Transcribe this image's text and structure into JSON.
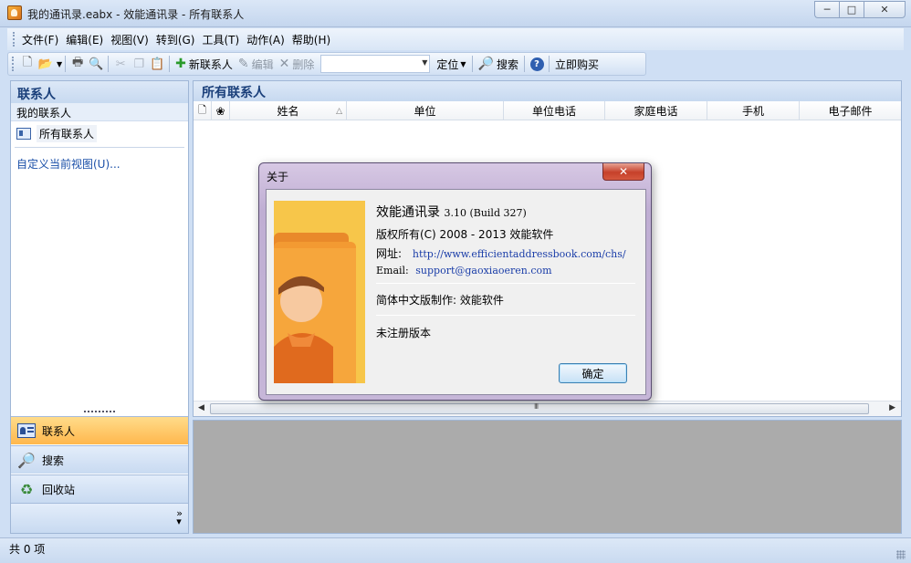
{
  "window": {
    "title": "我的通讯录.eabx - 效能通讯录 - 所有联系人",
    "min": "─",
    "max": "□",
    "close": "✕"
  },
  "menu": [
    "文件(F)",
    "编辑(E)",
    "视图(V)",
    "转到(G)",
    "工具(T)",
    "动作(A)",
    "帮助(H)"
  ],
  "toolbar": {
    "new_contact": "新联系人",
    "edit": "编辑",
    "delete": "删除",
    "locate": "定位",
    "search": "搜索",
    "buy": "立即购买"
  },
  "left_pane": {
    "header": "联系人",
    "group": "我的联系人",
    "folder": "所有联系人",
    "custom_view": "自定义当前视图(U)..."
  },
  "nav": {
    "contacts": "联系人",
    "search": "搜索",
    "recycle": "回收站"
  },
  "right_pane": {
    "header": "所有联系人",
    "columns": [
      "姓名",
      "单位",
      "单位电话",
      "家庭电话",
      "手机",
      "电子邮件"
    ]
  },
  "status": {
    "count": "共 0 项"
  },
  "about": {
    "title": "关于",
    "product": "效能通讯录",
    "version": "3.10 (Build 327)",
    "copyright": "版权所有(C) 2008 - 2013 效能软件",
    "url_label": "网址:",
    "url": "http://www.efficientaddressbook.com/chs/",
    "email_label": "Email:",
    "email": "support@gaoxiaoeren.com",
    "localization": "简体中文版制作: 效能软件",
    "license": "未注册版本",
    "ok": "确定"
  },
  "colors": {
    "accent": "#1a3f7a",
    "active_nav": "#ffb74d",
    "preview_bg": "#ababab"
  }
}
